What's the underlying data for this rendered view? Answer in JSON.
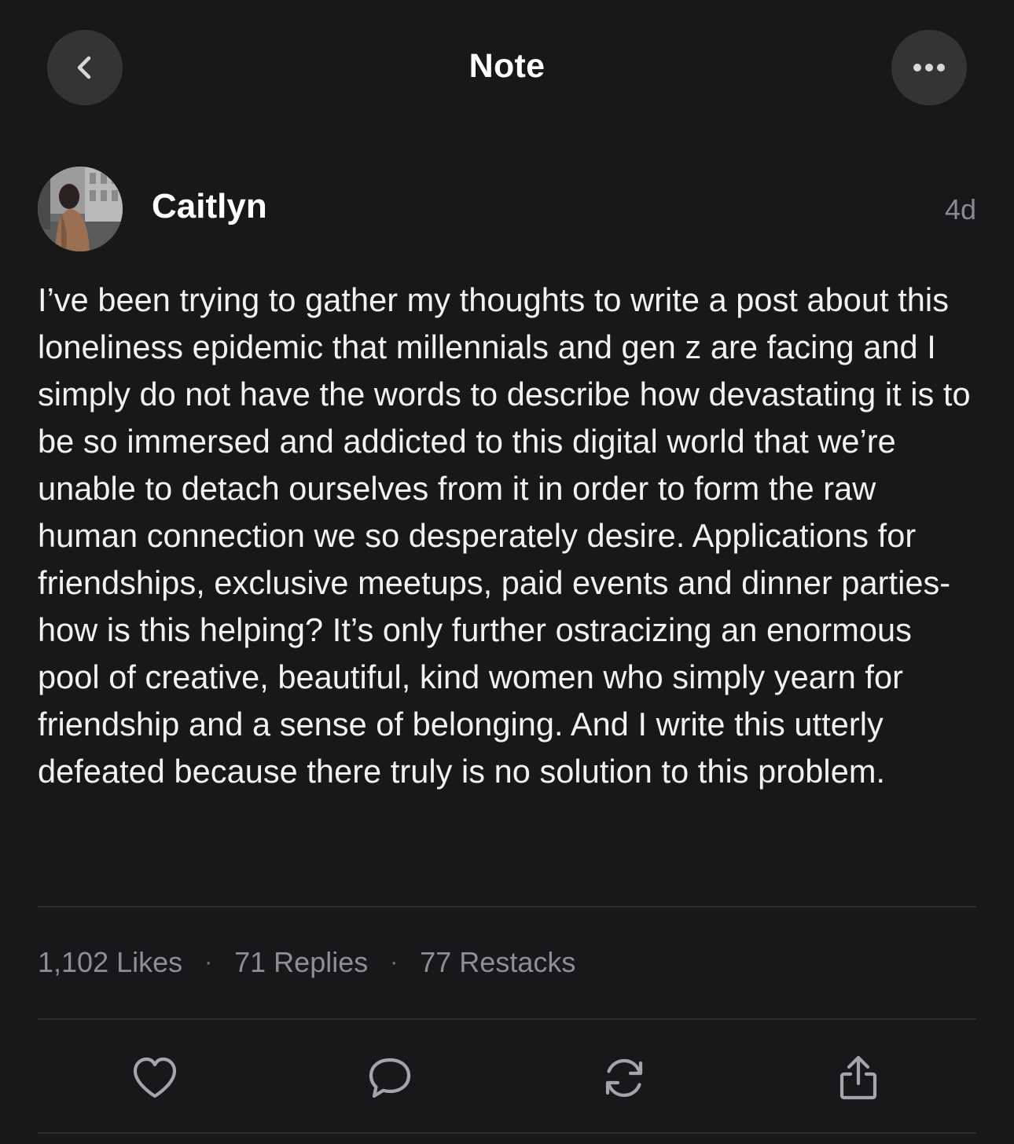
{
  "header": {
    "title": "Note",
    "back_icon": "chevron-left-icon",
    "more_icon": "ellipsis-icon"
  },
  "note": {
    "author": "Caitlyn",
    "timestamp": "4d",
    "body": "I’ve been trying to gather my thoughts to write a post about this loneliness epidemic that millennials and gen z are facing and I simply do not have the words to describe how devastating it is to be so immersed and addicted to this digital world that we’re unable to detach ourselves from it in order to form the raw human connection we so desperately desire. Applications for friendships, exclusive meetups, paid events and dinner parties- how is this helping? It’s only further ostracizing an enormous pool of creative, beautiful, kind women who simply yearn for friendship and a sense of belonging. And I write this utterly defeated because there truly is no solution to this problem."
  },
  "stats": {
    "likes": "1,102 Likes",
    "replies": "71 Replies",
    "restacks": "77 Restacks",
    "separator": "·"
  },
  "actions": [
    {
      "icon": "heart-icon"
    },
    {
      "icon": "comment-icon"
    },
    {
      "icon": "restack-icon"
    },
    {
      "icon": "share-icon"
    }
  ],
  "colors": {
    "background": "#18181a",
    "button_bg": "#343436",
    "text_primary": "#ffffff",
    "text_secondary": "#8e8e93",
    "divider": "#2d2d30"
  }
}
